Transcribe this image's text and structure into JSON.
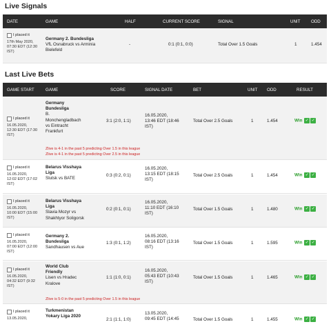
{
  "live_signals": {
    "title": "Live Signals",
    "headers": [
      "DATE",
      "GAME",
      "HALF",
      "CURRENT SCORE",
      "SIGNAL",
      "UNIT",
      "ODD"
    ],
    "row": {
      "placed_label": "I placed it",
      "date_lines": [
        "17th May 2020,",
        "07:30 EDT (12:30",
        "IST)"
      ],
      "league": "Germany 2. Bundesliga",
      "game_lines": [
        "VfL Osnabruck vs Arminia",
        "Bielefeld"
      ],
      "half": "-",
      "score": "0:1 (0:1, 0:0)",
      "signal": "Total Over 1.5 Goals",
      "unit": "1",
      "odd": "1.454"
    }
  },
  "last_live_bets": {
    "title": "Last Live Bets",
    "headers": [
      "GAME START",
      "GAME",
      "SCORE",
      "SIGNAL DATE",
      "BET",
      "UNIT",
      "ODD",
      "RESULT"
    ],
    "rows": [
      {
        "placed_label": "I placed it",
        "start_lines": [
          "16.05.2020,",
          "12:30 EDT (17:30",
          "IST)"
        ],
        "league_lines": [
          "Germany",
          "Bundesliga"
        ],
        "game_lines": [
          "B.",
          "Monchengladbach",
          "vs Eintracht",
          "Frankfurt"
        ],
        "score": "3:1 (2:0, 1:1)",
        "signal_date_lines": [
          "16.05.2020,",
          "13:46 EDT (18:46",
          "IST)"
        ],
        "bet": "Total Over 2.5 Goals",
        "unit": "1",
        "odd": "1.454",
        "result": "Win",
        "notes": [
          "Zlive is 4-1 in the past 5 predicting Over 1.5 in this league",
          "Zlive is 4-1 in the past 5 predicting Over 2.5 in this league"
        ]
      },
      {
        "placed_label": "I placed it",
        "start_lines": [
          "16.05.2020,",
          "12:02 EDT (17:02",
          "IST)"
        ],
        "league_lines": [
          "Belarus Visshaya",
          "Liga"
        ],
        "game_lines": [
          "Slutsk vs BATE"
        ],
        "score": "0:3 (0:2, 0:1)",
        "signal_date_lines": [
          "16.05.2020,",
          "13:15 EDT (18:15",
          "IST)"
        ],
        "bet": "Total Over 2.5 Goals",
        "unit": "1",
        "odd": "1.454",
        "result": "Win",
        "notes": []
      },
      {
        "placed_label": "I placed it",
        "start_lines": [
          "16.05.2020,",
          "10:00 EDT (15:00",
          "IST)"
        ],
        "league_lines": [
          "Belarus Visshaya",
          "Liga"
        ],
        "game_lines": [
          "Slavia Mozyr vs",
          "Shakhtyor Soligorsk"
        ],
        "score": "0:2 (0:1, 0:1)",
        "signal_date_lines": [
          "16.05.2020,",
          "11:10 EDT (16:10",
          "IST)"
        ],
        "bet": "Total Over 1.5 Goals",
        "unit": "1",
        "odd": "1.480",
        "result": "Win",
        "notes": []
      },
      {
        "placed_label": "I placed it",
        "start_lines": [
          "16.05.2020,",
          "07:00 EDT (12:00",
          "IST)"
        ],
        "league_lines": [
          "Germany 2.",
          "Bundesliga"
        ],
        "game_lines": [
          "Sandhausen vs Aue"
        ],
        "score": "1:3 (0:1, 1:2)",
        "signal_date_lines": [
          "16.05.2020,",
          "08:16 EDT (13:16",
          "IST)"
        ],
        "bet": "Total Over 1.5 Goals",
        "unit": "1",
        "odd": "1.595",
        "result": "Win",
        "notes": []
      },
      {
        "placed_label": "I placed it",
        "start_lines": [
          "16.05.2020,",
          "04:32 EDT (9:32",
          "IST)"
        ],
        "league_lines": [
          "World Club",
          "Friendly"
        ],
        "game_lines": [
          "Lisen vs Hradec",
          "Kralove"
        ],
        "score": "1:1 (1:0, 0:1)",
        "signal_date_lines": [
          "16.05.2020,",
          "05:43 EDT (10:43",
          "IST)"
        ],
        "bet": "Total Over 1.5 Goals",
        "unit": "1",
        "odd": "1.465",
        "result": "Win",
        "notes": [
          "Zlive is 5-0 in the past 5 predicting Over 1.5 in this league"
        ]
      },
      {
        "placed_label": "I placed it",
        "start_lines": [
          "13.05.2020,"
        ],
        "league_lines": [
          "Turkmenistan",
          "Yokary Liga 2020"
        ],
        "game_lines": [],
        "score": "2:1 (1:1, 1:0)",
        "signal_date_lines": [
          "13.05.2020,",
          "09:45 EDT (14:45"
        ],
        "bet": "Total Over 1.5 Goals",
        "unit": "1",
        "odd": "1.455",
        "result": "Win",
        "notes": []
      }
    ]
  },
  "icons": {
    "check": "checkmark-icon"
  },
  "colors": {
    "header_bg": "#2c2c2c",
    "win_green": "#2e9e2e",
    "note_red": "#cc2222"
  }
}
